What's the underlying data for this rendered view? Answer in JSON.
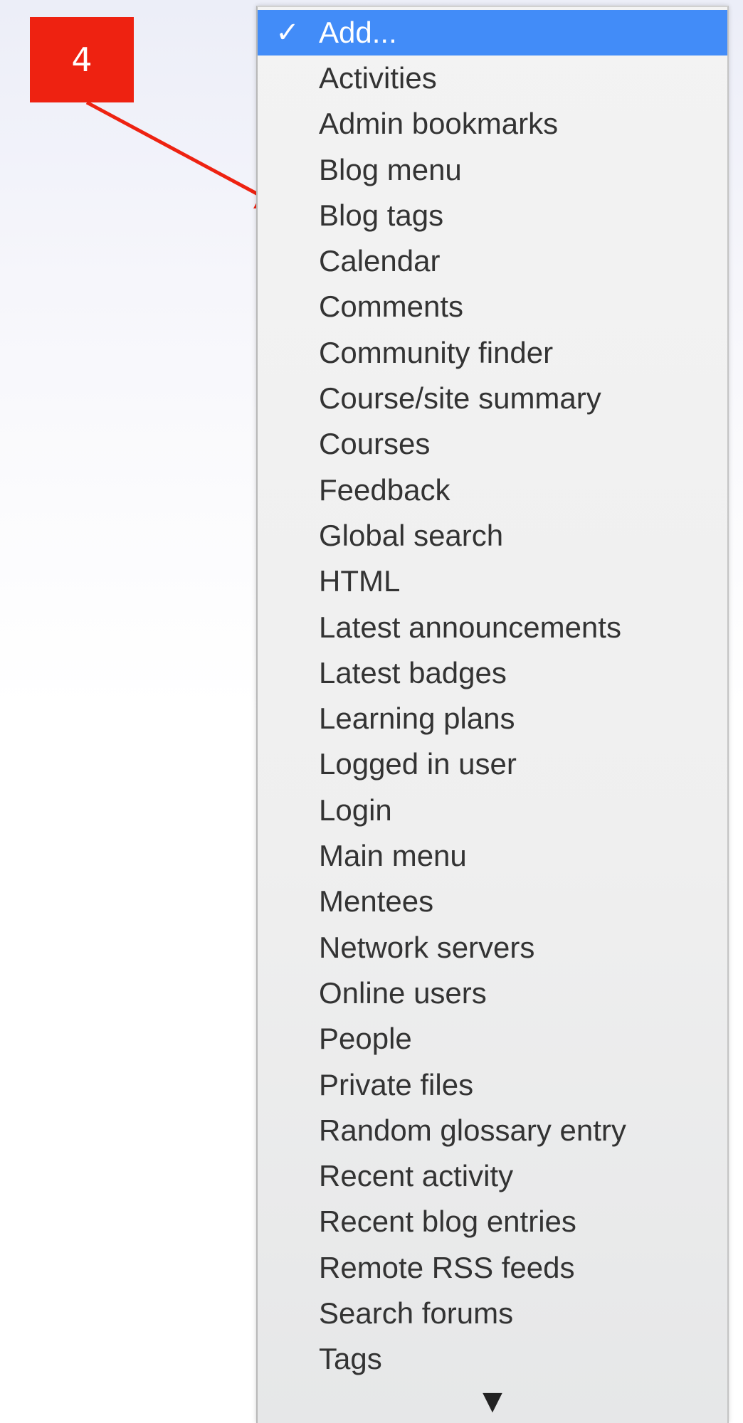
{
  "callout": {
    "number": "4",
    "color": "#ee2211"
  },
  "dropdown": {
    "selected_color": "#428cf8",
    "check_icon": "checkmark-icon",
    "scroll_icon": "triangle-down-icon",
    "items": [
      "Add...",
      "Activities",
      "Admin bookmarks",
      "Blog menu",
      "Blog tags",
      "Calendar",
      "Comments",
      "Community finder",
      "Course/site summary",
      "Courses",
      "Feedback",
      "Global search",
      "HTML",
      "Latest announcements",
      "Latest badges",
      "Learning plans",
      "Logged in user",
      "Login",
      "Main menu",
      "Mentees",
      "Network servers",
      "Online users",
      "People",
      "Private files",
      "Random glossary entry",
      "Recent activity",
      "Recent blog entries",
      "Remote RSS feeds",
      "Search forums",
      "Tags"
    ]
  }
}
